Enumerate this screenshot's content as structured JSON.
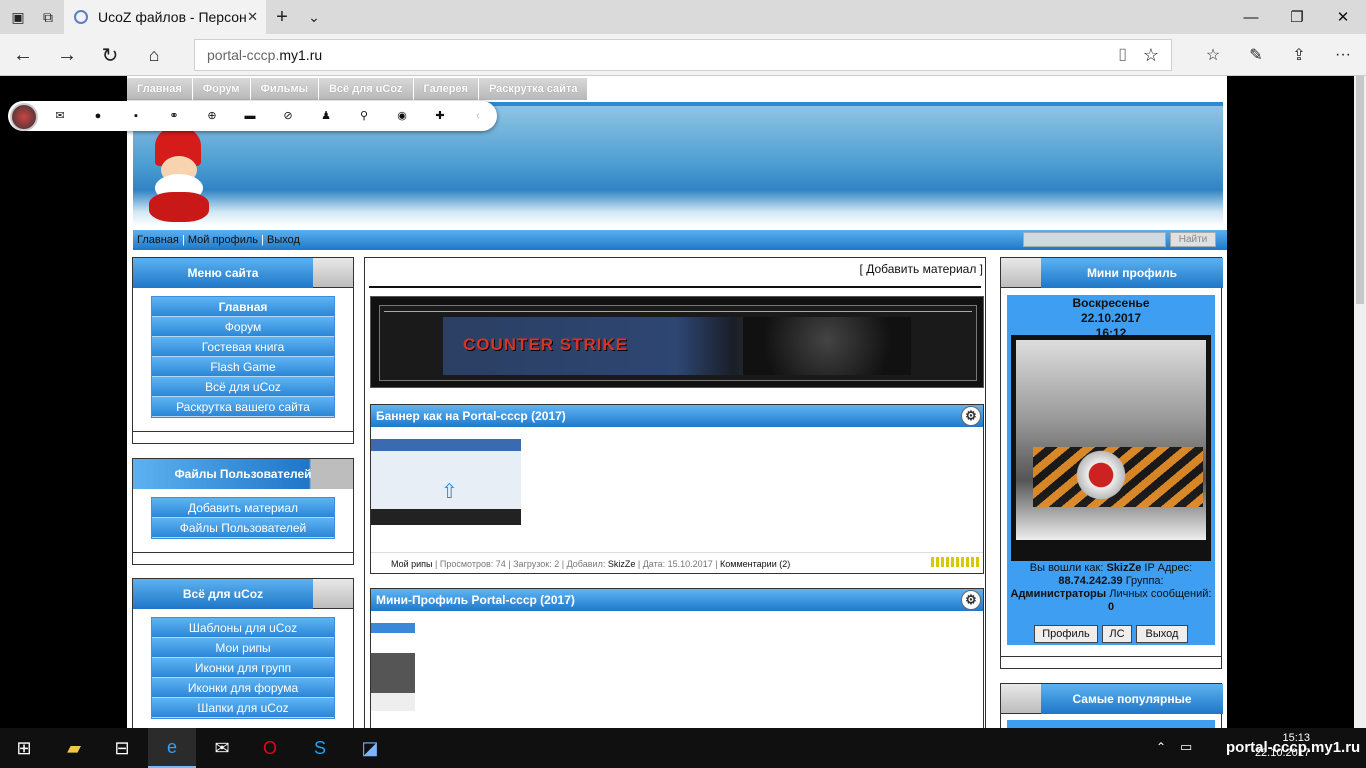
{
  "browser": {
    "tab_title": "UcoZ файлов - Персон",
    "url_host": "portal-cccp.",
    "url_rest": "my1.ru"
  },
  "top_menu": [
    "Главная",
    "Форум",
    "Фильмы",
    "Всё для uCoz",
    "Галерея",
    "Раскрутка сайта"
  ],
  "subnav": {
    "home": "Главная",
    "profile": "Мой профиль",
    "logout": "Выход",
    "sep": "|",
    "search_button": "Найти"
  },
  "site_menu": {
    "title": "Меню сайта",
    "items": [
      "Главная",
      "Форум",
      "Гостевая книга",
      "Flash Game",
      "Всё для uCoz",
      "Раскрутка вашего сайта"
    ]
  },
  "user_files": {
    "title": "Файлы Пользователей",
    "items": [
      "Добавить материал",
      "Файлы Пользователей"
    ]
  },
  "all_ucoz": {
    "title": "Всё для uCoz",
    "items": [
      "Шаблоны для uCoz",
      "Мои рипы",
      "Иконки для групп",
      "Иконки для форума",
      "Шапки для uCoz"
    ]
  },
  "center": {
    "add_material": "[ Добавить материал ]",
    "banner_text": "COUNTER STRIKE",
    "entries": [
      {
        "title": "Баннер как на Portal-cccp (2017)",
        "category": "Мой рипы",
        "views_label": "Просмотров:",
        "views": "74",
        "downloads_label": "Загрузок:",
        "downloads": "2",
        "author_label": "Добавил:",
        "author": "SkizZe",
        "date_label": "Дата:",
        "date": "15.10.2017",
        "comments": "Комментарии (2)"
      },
      {
        "title": "Мини-Профиль Portal-cccp (2017)"
      }
    ]
  },
  "mini_profile": {
    "title": "Мини профиль",
    "day": "Воскресенье",
    "date": "22.10.2017",
    "time": "16:12",
    "logged_as": "Вы вошли как:",
    "username": "SkizZe",
    "ip_label": "IP Адрес:",
    "ip": "88.74.242.39",
    "group_label": "Группа:",
    "group": "Администраторы",
    "messages_label": "Личных сообщений:",
    "messages": "0",
    "buttons": [
      "Профиль",
      "ЛС",
      "Выход"
    ]
  },
  "popular": {
    "title": "Самые популярные"
  },
  "taskbar": {
    "tray_url": "portal-cccp.my1.ru",
    "time": "15:13",
    "date": "22.10.2017"
  }
}
